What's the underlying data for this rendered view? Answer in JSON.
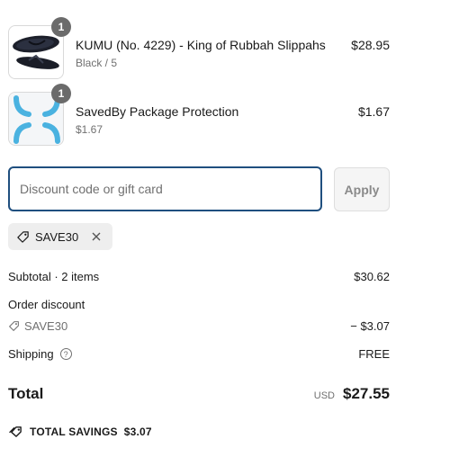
{
  "items": [
    {
      "title": "KUMU (No. 4229) - King of Rubbah Slippahs",
      "variant": "Black / 5",
      "price": "$28.95",
      "quantity": "1",
      "image_icon": "slipper-image"
    },
    {
      "title": "SavedBy Package Protection",
      "variant": "$1.67",
      "price": "$1.67",
      "quantity": "1",
      "image_icon": "package-protection-logo"
    }
  ],
  "discount": {
    "placeholder": "Discount code or gift card",
    "value": "",
    "apply_label": "Apply",
    "applied_code": "SAVE30"
  },
  "summary": {
    "subtotal_label": "Subtotal · 2 items",
    "subtotal_value": "$30.62",
    "order_discount_label": "Order discount",
    "discount_code": "SAVE30",
    "discount_value": "− $3.07",
    "shipping_label": "Shipping",
    "shipping_value": "FREE",
    "total_label": "Total",
    "currency": "USD",
    "total_value": "$27.55",
    "savings_label": "TOTAL SAVINGS",
    "savings_value": "$3.07"
  },
  "colors": {
    "input_border": "#1f4f7f",
    "qty_badge": "#6b6b6b",
    "muted_text": "#707070",
    "logo_blue": "#4ab2e0"
  }
}
